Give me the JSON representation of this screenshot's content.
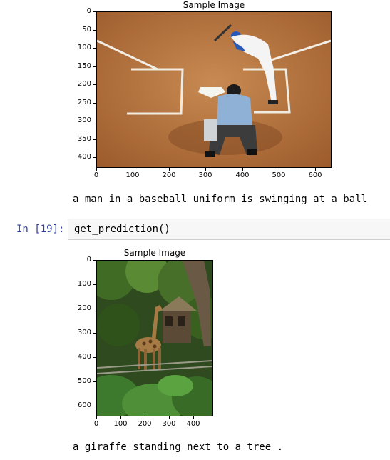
{
  "cells": [
    {
      "plot": {
        "title": "Sample Image",
        "y_ticks": [
          "0",
          "50",
          "100",
          "150",
          "200",
          "250",
          "300",
          "350",
          "400"
        ],
        "x_ticks": [
          "0",
          "100",
          "200",
          "300",
          "400",
          "500",
          "600"
        ]
      },
      "caption": "a man in a baseball uniform is swinging at a ball"
    },
    {
      "prompt": "In [19]:",
      "code": "get_prediction()",
      "plot": {
        "title": "Sample Image",
        "y_ticks": [
          "0",
          "100",
          "200",
          "300",
          "400",
          "500",
          "600"
        ],
        "x_ticks": [
          "0",
          "100",
          "200",
          "300",
          "400"
        ]
      },
      "caption": "a giraffe standing next to a tree ."
    }
  ]
}
